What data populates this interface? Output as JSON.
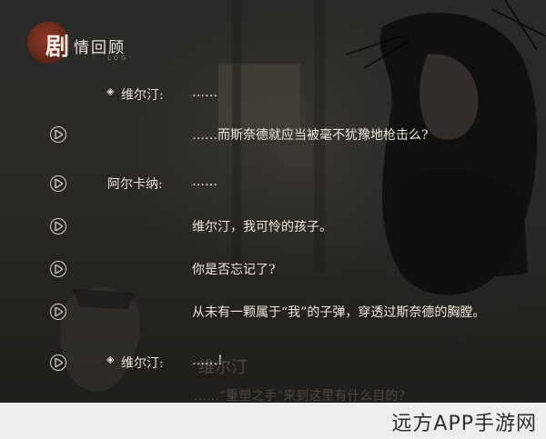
{
  "header": {
    "title_first": "剧",
    "title_rest": "情回顾",
    "subtitle": "LOG"
  },
  "entries": [
    {
      "speaker": "维尔汀:",
      "marker": "◈",
      "text": "……",
      "has_play": false
    },
    {
      "speaker": "",
      "marker": "",
      "text": "……而斯奈德就应当被毫不犹豫地枪击么?",
      "has_play": true
    },
    {
      "speaker": "阿尔卡纳:",
      "marker": "",
      "text": "……",
      "has_play": true
    },
    {
      "speaker": "",
      "marker": "",
      "text": "维尔汀，我可怜的孩子。",
      "has_play": true
    },
    {
      "speaker": "",
      "marker": "",
      "text": "你是否忘记了?",
      "has_play": true
    },
    {
      "speaker": "",
      "marker": "",
      "text": "从未有一颗属于“我”的子弹，穿透过斯奈德的胸膛。",
      "has_play": true
    },
    {
      "speaker": "维尔汀:",
      "marker": "◈",
      "text": "……!",
      "has_play": true
    }
  ],
  "ghost_text": {
    "name": "维尔汀",
    "line": "……“重塑之手”来到这里有什么目的?"
  },
  "watermark": "远方APP手游网",
  "colors": {
    "accent_circle": "#7a3020",
    "text": "#eee7dc"
  }
}
